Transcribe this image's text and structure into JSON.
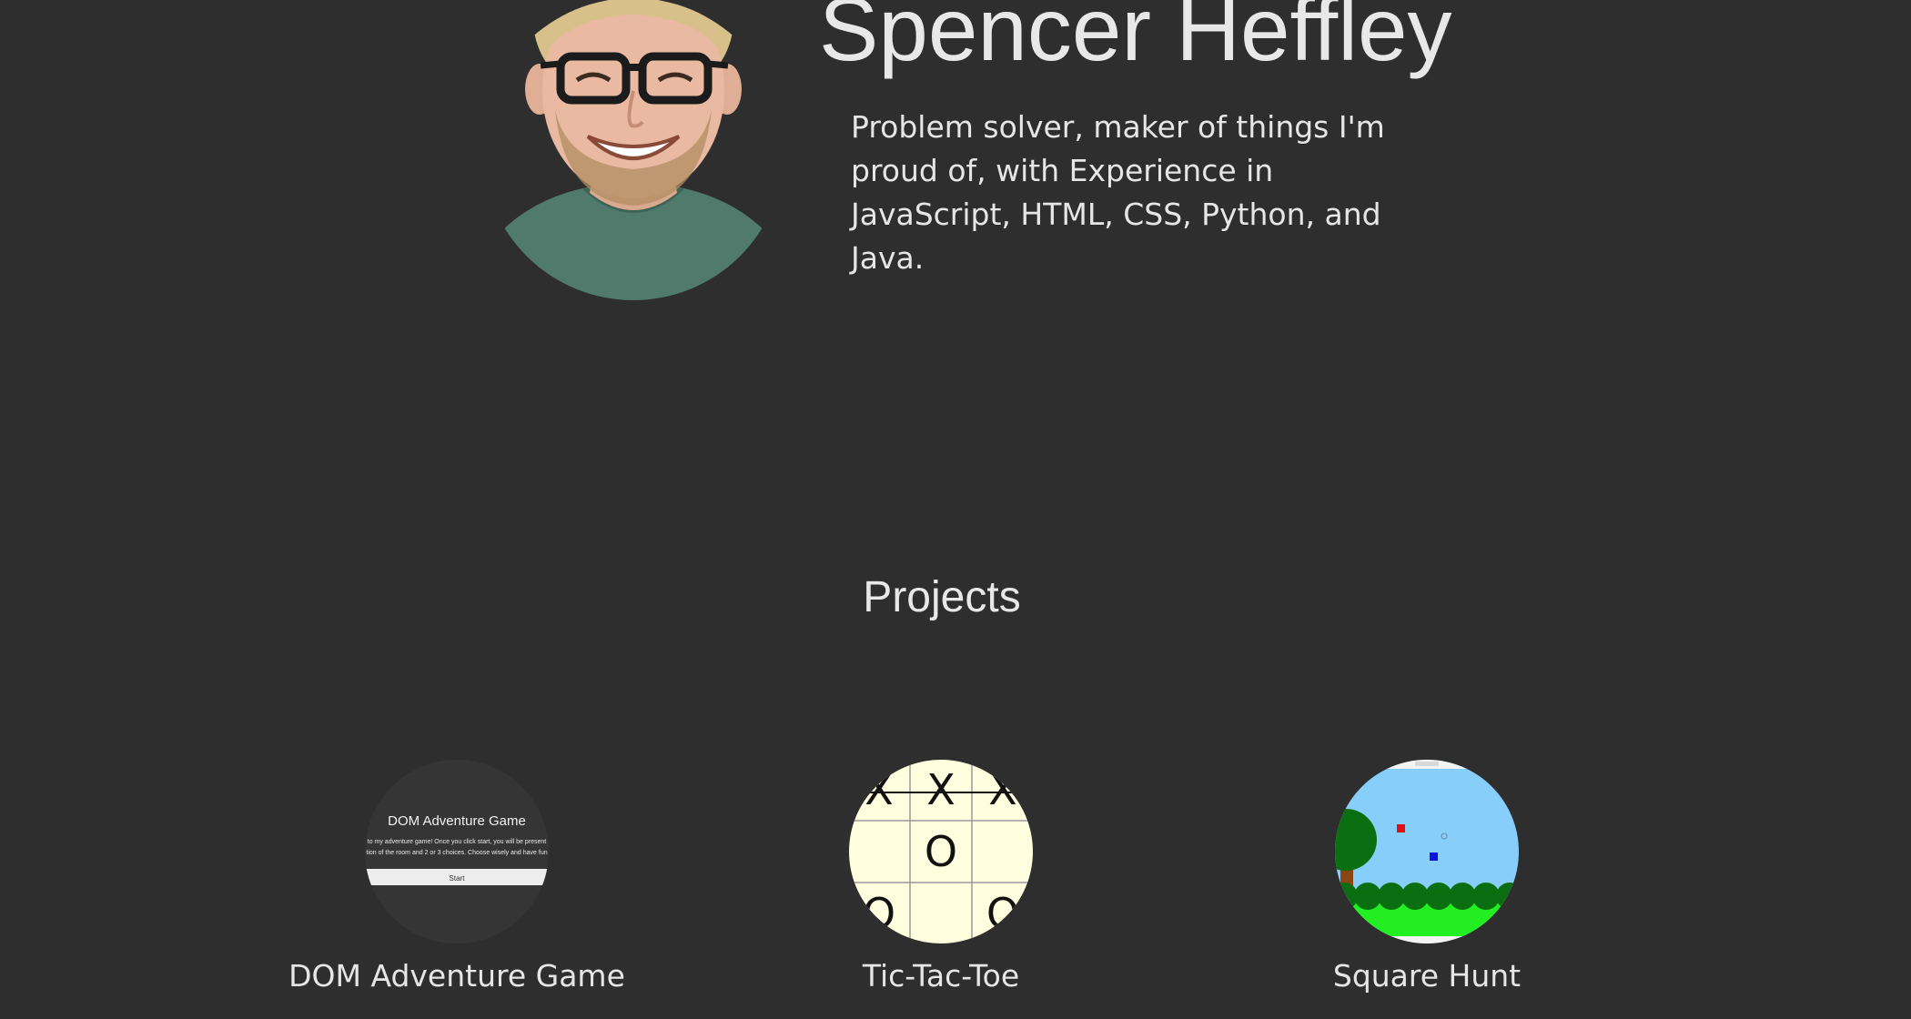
{
  "header": {
    "name": "Spencer Heffley",
    "tagline": "Problem solver, maker of things I'm proud of, with Experience in JavaScript, HTML, CSS, Python, and Java."
  },
  "projects": {
    "title": "Projects",
    "items": [
      {
        "label": "DOM Adventure Game",
        "thumb_title": "DOM Adventure Game",
        "thumb_line1": "to my adventure game! Once you click start, you will be present",
        "thumb_line2": "tion of the room and 2 or 3 choices. Choose wisely and have fun",
        "thumb_button": "Start"
      },
      {
        "label": "Tic-Tac-Toe",
        "board": [
          "X",
          "X",
          "X",
          "",
          "O",
          "",
          "O",
          "",
          "O"
        ]
      },
      {
        "label": "Square Hunt"
      }
    ]
  },
  "colors": {
    "background": "#2e2e2e",
    "text": "#e6e6e6",
    "tictactoe_board": "#ffffe0",
    "sky": "#87cefa",
    "grass": "#22ee22",
    "bushes": "#0b6e10",
    "red_square": "#e01010",
    "blue_square": "#1010e0"
  }
}
